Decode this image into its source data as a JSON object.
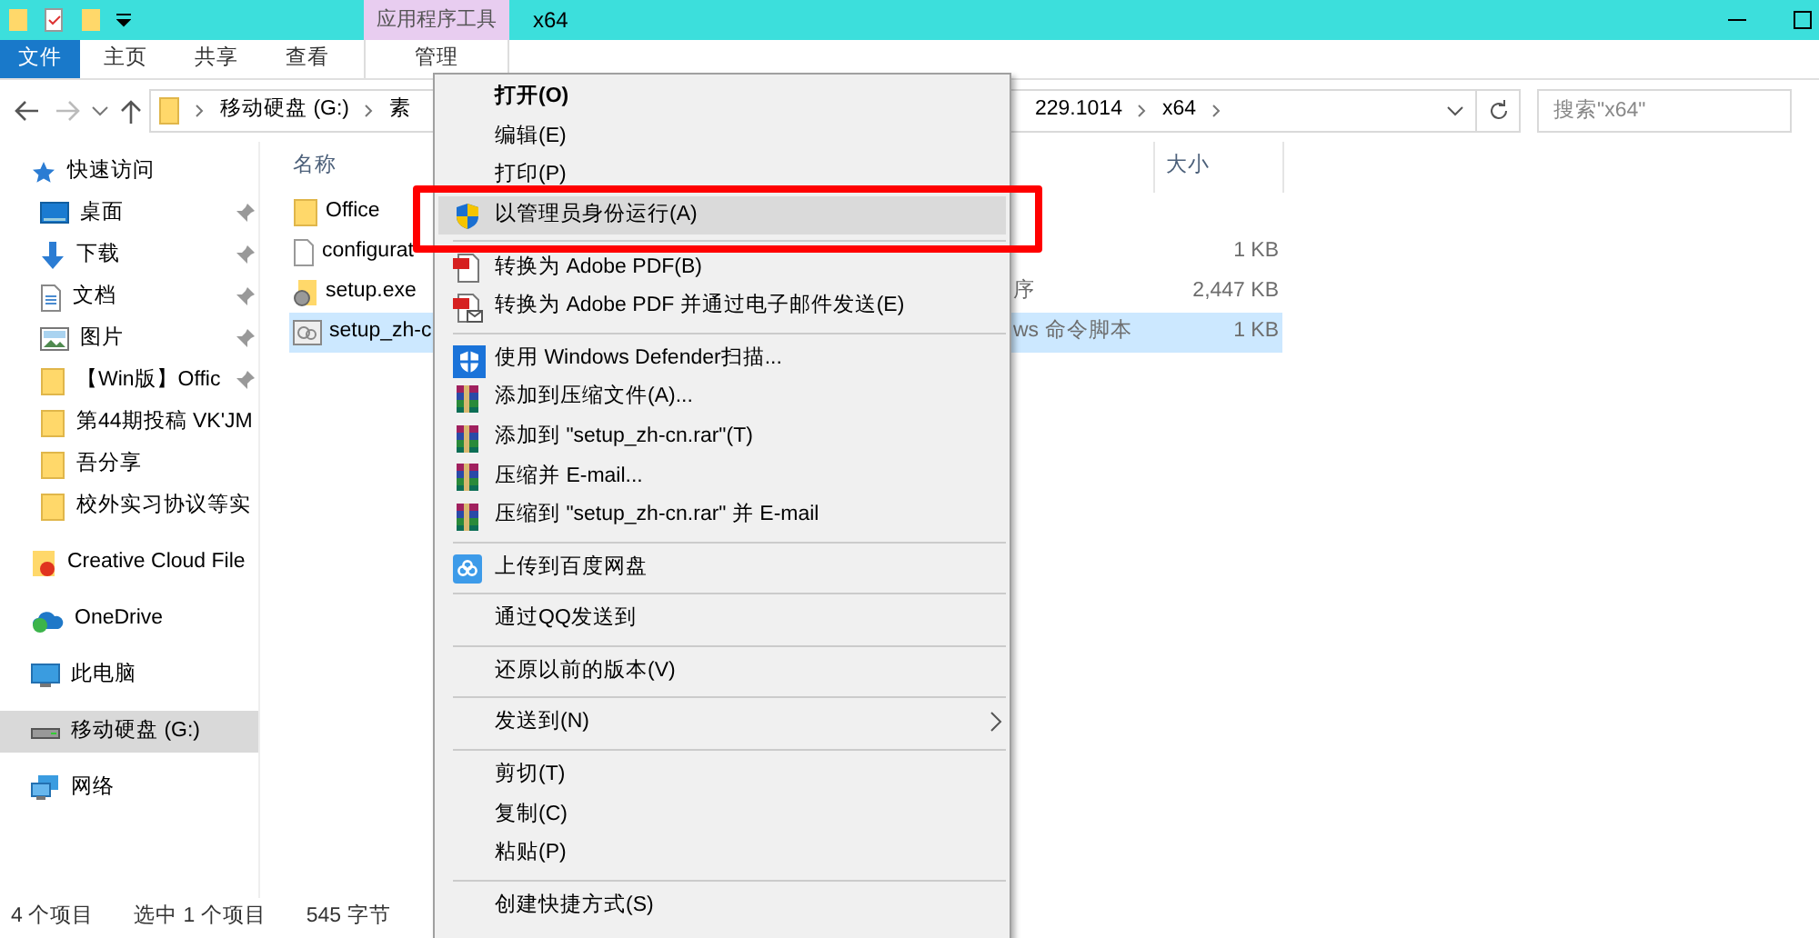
{
  "window": {
    "title": "x64",
    "contextual_group": "应用程序工具"
  },
  "ribbon_tabs": [
    {
      "label": "文件",
      "kind": "file",
      "selected": false
    },
    {
      "label": "主页",
      "kind": "tab",
      "selected": false
    },
    {
      "label": "共享",
      "kind": "tab",
      "selected": false
    },
    {
      "label": "查看",
      "kind": "tab",
      "selected": false
    },
    {
      "label": "管理",
      "kind": "contextual",
      "selected": false
    }
  ],
  "address": {
    "crumbs": [
      "移动硬盘 (G:)",
      "素",
      "229.1014",
      "x64"
    ]
  },
  "search": {
    "placeholder": "搜索\"x64\""
  },
  "sidebar": {
    "items": [
      {
        "label": "快速访问",
        "kind": "star",
        "pinned": false,
        "selected": false
      },
      {
        "label": "桌面",
        "kind": "desktop",
        "pinned": true,
        "selected": false
      },
      {
        "label": "下载",
        "kind": "download",
        "pinned": true,
        "selected": false
      },
      {
        "label": "文档",
        "kind": "document",
        "pinned": true,
        "selected": false
      },
      {
        "label": "图片",
        "kind": "pictures",
        "pinned": true,
        "selected": false
      },
      {
        "label": "【Win版】Offic",
        "kind": "folder",
        "pinned": true,
        "selected": false
      },
      {
        "label": "第44期投稿 VK'JM",
        "kind": "folder",
        "pinned": false,
        "selected": false
      },
      {
        "label": "吾分享",
        "kind": "folder",
        "pinned": false,
        "selected": false
      },
      {
        "label": "校外实习协议等实",
        "kind": "folder",
        "pinned": false,
        "selected": false
      },
      {
        "label": "Creative Cloud File",
        "kind": "cc",
        "pinned": false,
        "selected": false
      },
      {
        "label": "OneDrive",
        "kind": "onedrive",
        "pinned": false,
        "selected": false
      },
      {
        "label": "此电脑",
        "kind": "pc",
        "pinned": false,
        "selected": false
      },
      {
        "label": "移动硬盘 (G:)",
        "kind": "drive",
        "pinned": false,
        "selected": true
      },
      {
        "label": "网络",
        "kind": "network",
        "pinned": false,
        "selected": false
      }
    ]
  },
  "files": {
    "columns": [
      "名称",
      "大小"
    ],
    "rows": [
      {
        "name": "Office",
        "kind": "folder",
        "selected": false
      },
      {
        "name": "configurat",
        "kind": "file",
        "size": "1 KB",
        "selected": false
      },
      {
        "name": "setup.exe",
        "kind": "exe",
        "type": "序",
        "size": "2,447 KB",
        "selected": false
      },
      {
        "name": "setup_zh-c",
        "kind": "script",
        "type": "ws 命令脚本",
        "size": "1 KB",
        "selected": true
      }
    ]
  },
  "context_menu": {
    "items": [
      {
        "kind": "plain",
        "label": "打开(O)",
        "default": true,
        "selected": false
      },
      {
        "kind": "plain",
        "label": "编辑(E)",
        "selected": false
      },
      {
        "kind": "plain",
        "label": "打印(P)",
        "selected": false
      },
      {
        "kind": "shield",
        "label": "以管理员身份运行(A)",
        "selected": true,
        "highlighted": true
      },
      {
        "kind": "separator"
      },
      {
        "kind": "pdf",
        "label": "转换为 Adobe PDF(B)",
        "selected": false
      },
      {
        "kind": "pdfmail",
        "label": "转换为 Adobe PDF 并通过电子邮件发送(E)",
        "selected": false
      },
      {
        "kind": "separator"
      },
      {
        "kind": "defender",
        "label": "使用 Windows Defender扫描...",
        "selected": false
      },
      {
        "kind": "rar",
        "label": "添加到压缩文件(A)...",
        "selected": false
      },
      {
        "kind": "rar",
        "label": "添加到 \"setup_zh-cn.rar\"(T)",
        "selected": false
      },
      {
        "kind": "rar",
        "label": "压缩并 E-mail...",
        "selected": false
      },
      {
        "kind": "rar",
        "label": "压缩到 \"setup_zh-cn.rar\" 并 E-mail",
        "selected": false
      },
      {
        "kind": "separator"
      },
      {
        "kind": "cloud",
        "label": "上传到百度网盘",
        "selected": false
      },
      {
        "kind": "separator"
      },
      {
        "kind": "plain",
        "label": "通过QQ发送到",
        "selected": false
      },
      {
        "kind": "separator"
      },
      {
        "kind": "plain",
        "label": "还原以前的版本(V)",
        "selected": false
      },
      {
        "kind": "separator"
      },
      {
        "kind": "plain",
        "label": "发送到(N)",
        "submenu": true,
        "selected": false
      },
      {
        "kind": "separator"
      },
      {
        "kind": "plain",
        "label": "剪切(T)",
        "selected": false
      },
      {
        "kind": "plain",
        "label": "复制(C)",
        "selected": false
      },
      {
        "kind": "plain",
        "label": "粘贴(P)",
        "selected": false
      },
      {
        "kind": "separator"
      },
      {
        "kind": "plain",
        "label": "创建快捷方式(S)",
        "selected": false
      }
    ]
  },
  "status_bar": {
    "items": [
      "4 个项目",
      "选中 1 个项目",
      "545 字节"
    ]
  }
}
